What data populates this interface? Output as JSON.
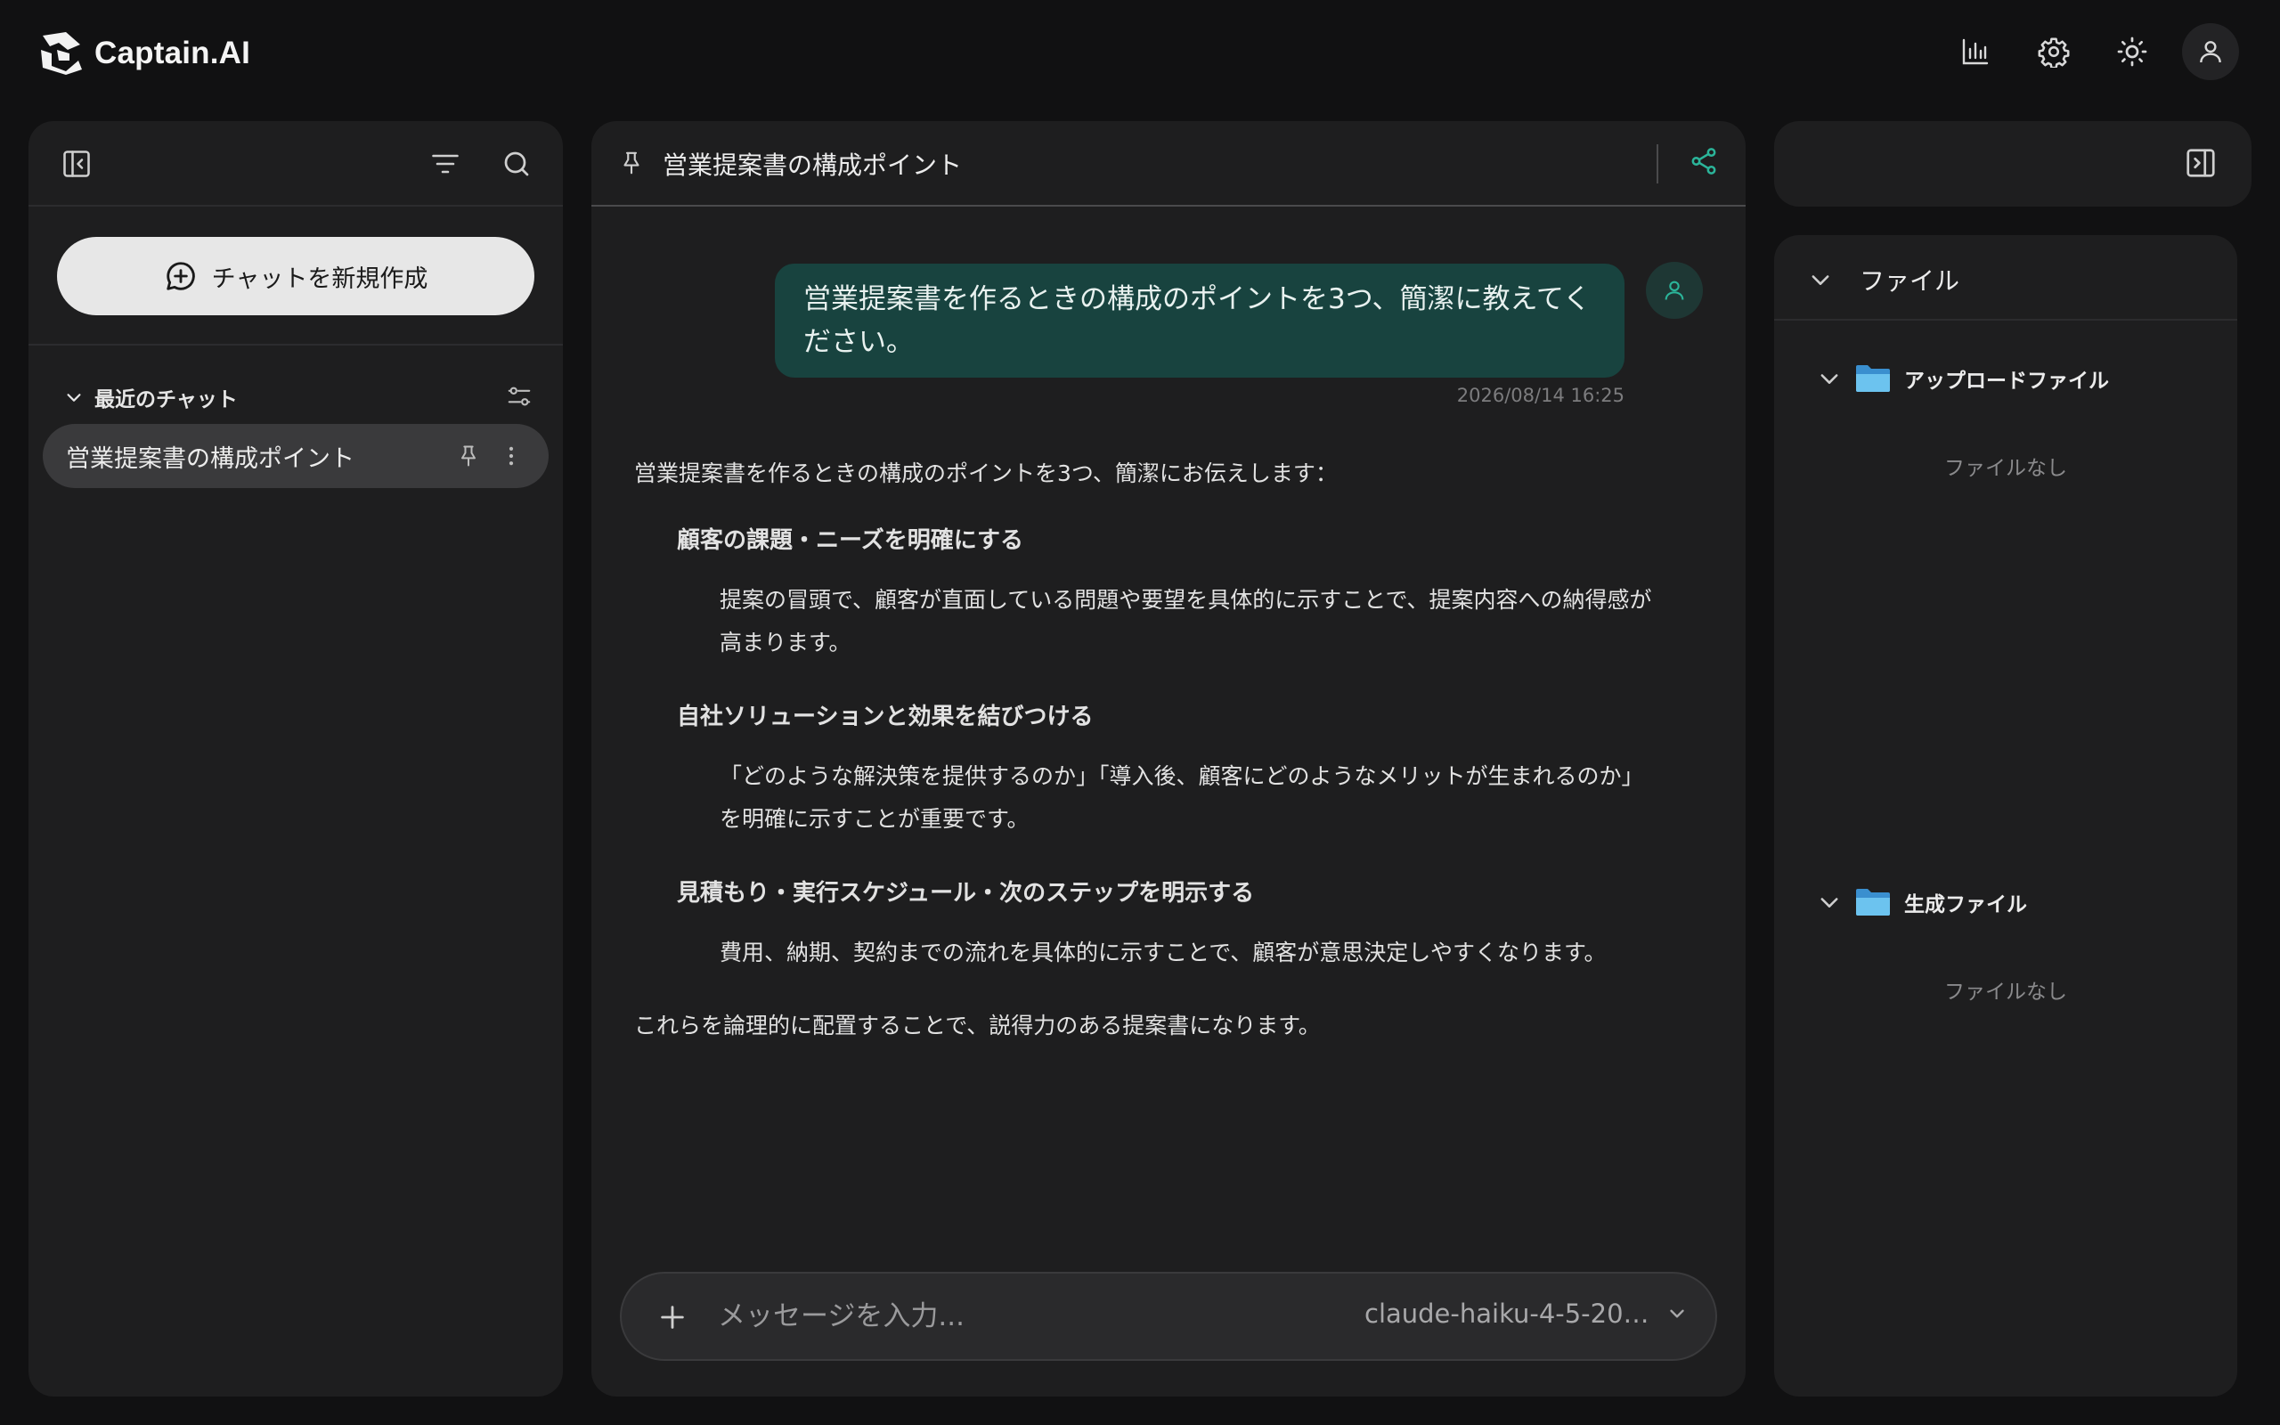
{
  "app": {
    "name": "Captain.AI"
  },
  "top_actions": [
    {
      "name": "stats-icon"
    },
    {
      "name": "settings-icon"
    },
    {
      "name": "theme-icon"
    },
    {
      "name": "user-icon"
    }
  ],
  "sidebar": {
    "new_chat_label": "チャットを新規作成",
    "recent_title": "最近のチャット",
    "chats": [
      {
        "label": "営業提案書の構成ポイント",
        "pinned": true
      }
    ]
  },
  "conversation": {
    "title": "営業提案書の構成ポイント",
    "user_message": "営業提案書を作るときの構成のポイントを3つ、簡潔に教えてください。",
    "user_message_time": "2026/08/14 16:25",
    "answer": {
      "intro": "営業提案書を作るときの構成のポイントを3つ、簡潔にお伝えします：",
      "points": [
        {
          "heading": "顧客の課題・ニーズを明確にする",
          "body": "提案の冒頭で、顧客が直面している問題や要望を具体的に示すことで、提案内容への納得感が高まります。"
        },
        {
          "heading": "自社ソリューションと効果を結びつける",
          "body": "「どのような解決策を提供するのか」「導入後、顧客にどのようなメリットが生まれるのか」を明確に示すことが重要です。"
        },
        {
          "heading": "見積もり・実行スケジュール・次のステップを明示する",
          "body": "費用、納期、契約までの流れを具体的に示すことで、顧客が意思決定しやすくなります。"
        }
      ],
      "outro": "これらを論理的に配置することで、説得力のある提案書になります。"
    }
  },
  "composer": {
    "placeholder": "メッセージを入力...",
    "value": "",
    "model": "claude-haiku-4-5-20…"
  },
  "files_panel": {
    "title": "ファイル",
    "folders": [
      {
        "label": "アップロードファイル",
        "empty_text": "ファイルなし"
      },
      {
        "label": "生成ファイル",
        "empty_text": "ファイルなし"
      }
    ]
  },
  "colors": {
    "background": "#111112",
    "panel": "#1e1e1f",
    "accent": "#2bb59a",
    "user_bubble": "#18433f",
    "folder": "#5ab8e8"
  }
}
